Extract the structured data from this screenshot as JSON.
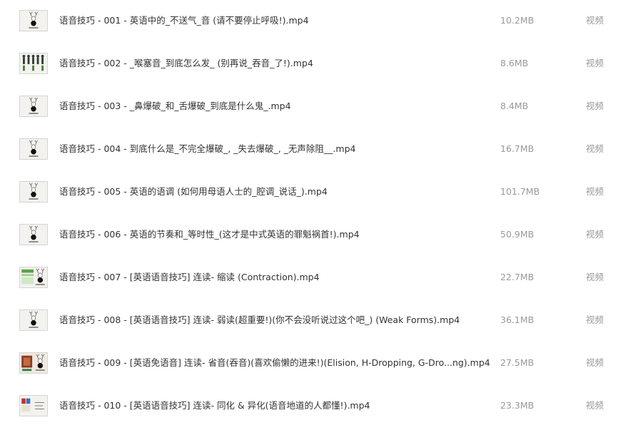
{
  "files": [
    {
      "name": "语音技巧 - 001 - 英语中的_不送气_音 (请不要停止呼吸!).mp4",
      "size": "10.2MB",
      "type": "视频",
      "thumb": "default"
    },
    {
      "name": "语音技巧 - 002 - _喉塞音_到底怎么发_ (别再说_吞音_了!).mp4",
      "size": "8.6MB",
      "type": "视频",
      "thumb": "figures"
    },
    {
      "name": "语音技巧 - 003 - _鼻爆破_和_舌爆破_到底是什么鬼_.mp4",
      "size": "8.4MB",
      "type": "视频",
      "thumb": "default"
    },
    {
      "name": "语音技巧 - 004 - 到底什么是_不完全爆破_, _失去爆破_, _无声除阻__.mp4",
      "size": "16.7MB",
      "type": "视频",
      "thumb": "default"
    },
    {
      "name": "语音技巧 - 005 - 英语的语调 (如何用母语人士的_腔调_说话_).mp4",
      "size": "101.7MB",
      "type": "视频",
      "thumb": "default"
    },
    {
      "name": "语音技巧 - 006 - 英语的节奏和_等时性_(这才是中式英语的罪魁祸首!).mp4",
      "size": "50.9MB",
      "type": "视频",
      "thumb": "default"
    },
    {
      "name": "语音技巧 - 007 - [英语语音技巧] 连读- 缩读 (Contraction).mp4",
      "size": "22.7MB",
      "type": "视频",
      "thumb": "green"
    },
    {
      "name": "语音技巧 - 008 - [英语语音技巧] 连读- 弱读(超重要!)(你不会没听说过这个吧_) (Weak Forms).mp4",
      "size": "36.1MB",
      "type": "视频",
      "thumb": "default"
    },
    {
      "name": "语音技巧 - 009 - [英语免语音] 连读- 省音(吞音)(喜欢偷懒的进来!)(Elision, H-Dropping, G-Dro...ng).mp4",
      "size": "27.5MB",
      "type": "视频",
      "thumb": "photo"
    },
    {
      "name": "语音技巧 - 010 - [英语语音技巧] 连读- 同化 & 异化(语音地道的人都懂!).mp4",
      "size": "23.3MB",
      "type": "视频",
      "thumb": "red"
    }
  ]
}
